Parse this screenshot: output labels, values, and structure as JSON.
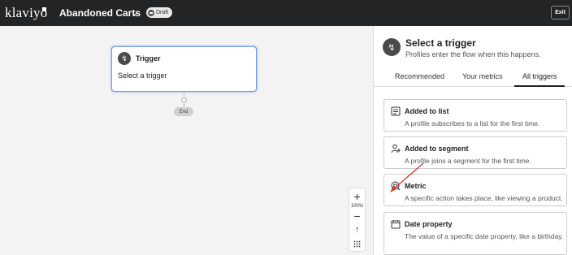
{
  "header": {
    "logo_text": "klaviyo",
    "flow_title": "Abandoned Carts",
    "badge": "Draft",
    "exit_label": "Exit"
  },
  "canvas": {
    "trigger_card": {
      "title": "Trigger",
      "subtitle": "Select a trigger"
    },
    "end_label": "End",
    "zoom": {
      "plus": "+",
      "level": "100%",
      "minus": "−"
    }
  },
  "panel": {
    "title": "Select a trigger",
    "subtitle": "Profiles enter the flow when this happens.",
    "tabs": [
      {
        "label": "Recommended"
      },
      {
        "label": "Your metrics"
      },
      {
        "label": "All triggers",
        "active": true
      }
    ],
    "options": [
      {
        "icon": "list-icon",
        "title": "Added to list",
        "desc": "A profile subscribes to a list for the first time."
      },
      {
        "icon": "user-add-icon",
        "title": "Added to segment",
        "desc": "A profile joins a segment for the first time."
      },
      {
        "icon": "metric-icon",
        "title": "Metric",
        "desc": "A specific action takes place, like viewing a product."
      },
      {
        "icon": "calendar-icon",
        "title": "Date property",
        "desc": "The value of a specific date property, like a birthday."
      }
    ]
  },
  "colors": {
    "topbar": "#232426",
    "canvas": "#f3f3f3",
    "selection_border": "#6d99e6",
    "annotation_arrow": "#d9342b"
  }
}
